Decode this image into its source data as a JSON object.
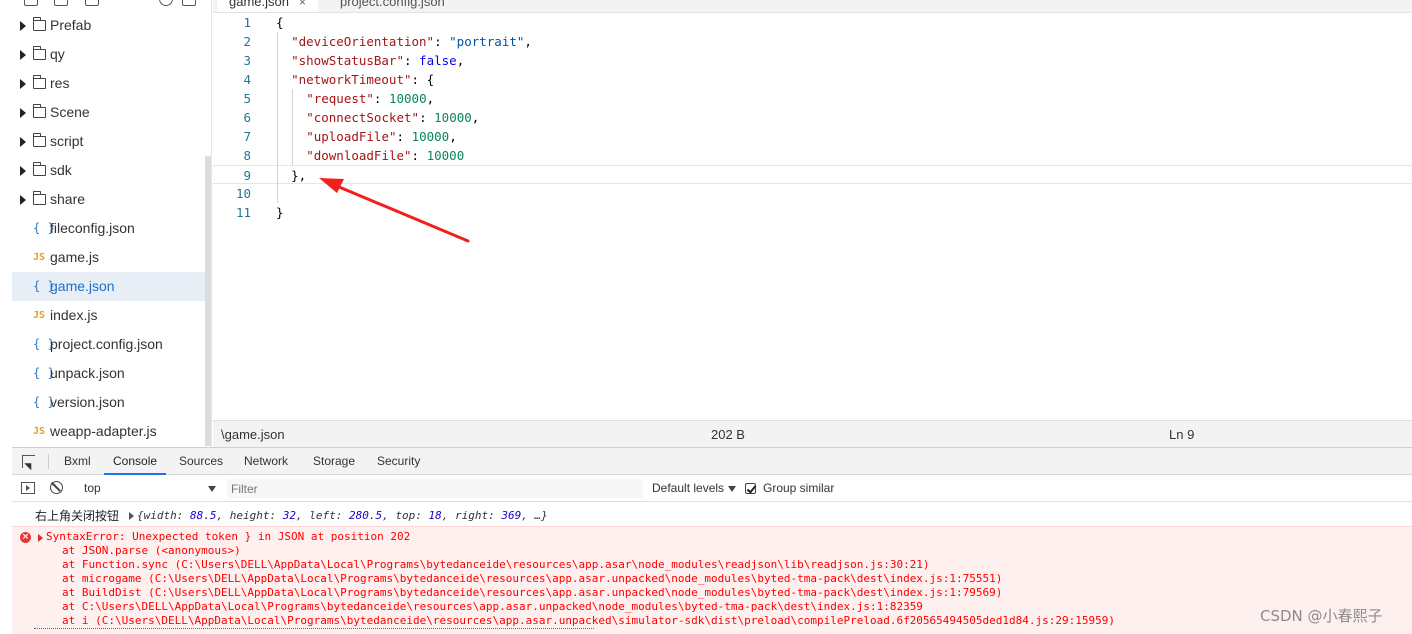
{
  "sidebar": {
    "items": [
      {
        "type": "folder",
        "icon": "folder-icon",
        "label": "Prefab"
      },
      {
        "type": "folder",
        "icon": "folder-icon",
        "label": "qy"
      },
      {
        "type": "folder",
        "icon": "folder-icon",
        "label": "res"
      },
      {
        "type": "folder",
        "icon": "folder-icon",
        "label": "Scene"
      },
      {
        "type": "folder",
        "icon": "folder-icon",
        "label": "script"
      },
      {
        "type": "folder",
        "icon": "folder-icon",
        "label": "sdk"
      },
      {
        "type": "folder",
        "icon": "folder-icon",
        "label": "share"
      },
      {
        "type": "json",
        "icon": "json-file-icon",
        "glyph": "{ }",
        "label": "fileconfig.json"
      },
      {
        "type": "js",
        "icon": "js-file-icon",
        "glyph": "JS",
        "label": "game.js"
      },
      {
        "type": "json",
        "icon": "json-file-icon",
        "glyph": "{ }",
        "label": "game.json",
        "active": true
      },
      {
        "type": "js",
        "icon": "js-file-icon",
        "glyph": "JS",
        "label": "index.js"
      },
      {
        "type": "json",
        "icon": "json-file-icon",
        "glyph": "{ }",
        "label": "project.config.json"
      },
      {
        "type": "json",
        "icon": "json-file-icon",
        "glyph": "{ }",
        "label": "unpack.json"
      },
      {
        "type": "json",
        "icon": "json-file-icon",
        "glyph": "{ }",
        "label": "version.json"
      },
      {
        "type": "js",
        "icon": "js-file-icon",
        "glyph": "JS",
        "label": "weapp-adapter.js"
      }
    ]
  },
  "editor": {
    "tabs": [
      {
        "label": "game.json",
        "close": "×"
      },
      {
        "label": "project.config.json"
      }
    ],
    "lines": [
      {
        "n": "1",
        "indent": 0,
        "tokens": [
          [
            "punc",
            "{"
          ]
        ]
      },
      {
        "n": "2",
        "indent": 2,
        "tokens": [
          [
            "key",
            "\"deviceOrientation\""
          ],
          [
            "punc",
            ": "
          ],
          [
            "str",
            "\"portrait\""
          ],
          [
            "punc",
            ","
          ]
        ]
      },
      {
        "n": "3",
        "indent": 2,
        "tokens": [
          [
            "key",
            "\"showStatusBar\""
          ],
          [
            "punc",
            ": "
          ],
          [
            "bool",
            "false"
          ],
          [
            "punc",
            ","
          ]
        ]
      },
      {
        "n": "4",
        "indent": 2,
        "tokens": [
          [
            "key",
            "\"networkTimeout\""
          ],
          [
            "punc",
            ": {"
          ]
        ]
      },
      {
        "n": "5",
        "indent": 4,
        "tokens": [
          [
            "key",
            "\"request\""
          ],
          [
            "punc",
            ": "
          ],
          [
            "num",
            "10000"
          ],
          [
            "punc",
            ","
          ]
        ]
      },
      {
        "n": "6",
        "indent": 4,
        "tokens": [
          [
            "key",
            "\"connectSocket\""
          ],
          [
            "punc",
            ": "
          ],
          [
            "num",
            "10000"
          ],
          [
            "punc",
            ","
          ]
        ]
      },
      {
        "n": "7",
        "indent": 4,
        "tokens": [
          [
            "key",
            "\"uploadFile\""
          ],
          [
            "punc",
            ": "
          ],
          [
            "num",
            "10000"
          ],
          [
            "punc",
            ","
          ]
        ]
      },
      {
        "n": "8",
        "indent": 4,
        "tokens": [
          [
            "key",
            "\"downloadFile\""
          ],
          [
            "punc",
            ": "
          ],
          [
            "num",
            "10000"
          ]
        ]
      },
      {
        "n": "9",
        "indent": 2,
        "tokens": [
          [
            "punc",
            "},"
          ]
        ],
        "current": true
      },
      {
        "n": "10",
        "indent": 0,
        "tokens": []
      },
      {
        "n": "11",
        "indent": 0,
        "tokens": [
          [
            "punc",
            "}"
          ]
        ]
      }
    ]
  },
  "statusbar": {
    "path": "\\game.json",
    "size": "202 B",
    "position": "Ln 9"
  },
  "devtools": {
    "tabs": [
      "Bxml",
      "Console",
      "Sources",
      "Network",
      "Storage",
      "Security"
    ],
    "active_tab": "Console",
    "context": "top",
    "filter_placeholder": "Filter",
    "levels": "Default levels",
    "group_similar": "Group similar",
    "group_similar_checked": true
  },
  "console": {
    "log": {
      "text": "右上角关闭按钮",
      "object": [
        [
          "width",
          "88.5"
        ],
        [
          "height",
          "32"
        ],
        [
          "left",
          "280.5"
        ],
        [
          "top",
          "18"
        ],
        [
          "right",
          "369"
        ]
      ],
      "object_more": "…"
    },
    "error": {
      "message": "SyntaxError: Unexpected token } in JSON at position 202",
      "stack": [
        "at JSON.parse (<anonymous>)",
        "at Function.sync (C:\\Users\\DELL\\AppData\\Local\\Programs\\bytedanceide\\resources\\app.asar\\node_modules\\readjson\\lib\\readjson.js:30:21)",
        "at microgame (C:\\Users\\DELL\\AppData\\Local\\Programs\\bytedanceide\\resources\\app.asar.unpacked\\node_modules\\byted-tma-pack\\dest\\index.js:1:75551)",
        "at BuildDist (C:\\Users\\DELL\\AppData\\Local\\Programs\\bytedanceide\\resources\\app.asar.unpacked\\node_modules\\byted-tma-pack\\dest\\index.js:1:79569)",
        "at C:\\Users\\DELL\\AppData\\Local\\Programs\\bytedanceide\\resources\\app.asar.unpacked\\node_modules\\byted-tma-pack\\dest\\index.js:1:82359",
        "at i (C:\\Users\\DELL\\AppData\\Local\\Programs\\bytedanceide\\resources\\app.asar.unpacked\\simulator-sdk\\dist\\preload\\compilePreload.6f20565494505ded1d84.js:29:15959)"
      ]
    }
  },
  "watermark": "CSDN @小春熙子",
  "annotation": {
    "color": "#f0211a"
  }
}
